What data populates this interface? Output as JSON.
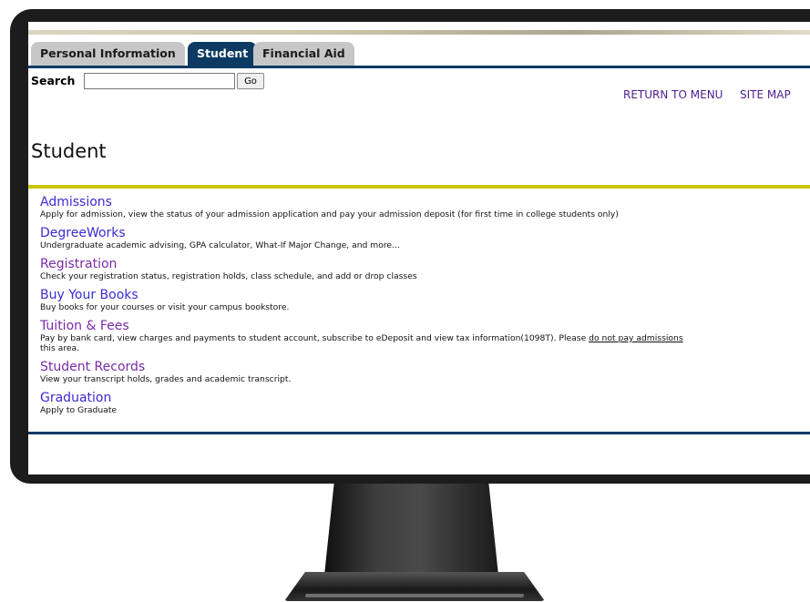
{
  "tabs": [
    {
      "label": "Personal Information",
      "active": false
    },
    {
      "label": "Student",
      "active": true
    },
    {
      "label": "Financial Aid",
      "active": false
    }
  ],
  "search": {
    "label": "Search",
    "value": "",
    "placeholder": "",
    "button_label": "Go"
  },
  "top_links": {
    "return_to_menu": "RETURN TO MENU",
    "site_map": "SITE MAP"
  },
  "page_title": "Student",
  "menu": [
    {
      "title": "Admissions",
      "description": "Apply for admission, view the status of your admission application and pay your admission deposit (for first time in college students only)"
    },
    {
      "title": "DegreeWorks",
      "description": "Undergraduate academic advising, GPA calculator, What-If Major Change, and more..."
    },
    {
      "title": "Registration",
      "description": "Check your registration status, registration holds, class schedule, and add or drop classes"
    },
    {
      "title": "Buy Your Books",
      "description": "Buy books for your courses or visit your campus bookstore."
    },
    {
      "title": "Tuition & Fees",
      "description_pre": "Pay by bank card, view charges and payments to student account, subscribe to eDeposit and view tax information(1098T). Please ",
      "description_link": "do not pay admissions",
      "description_post": "this area."
    },
    {
      "title": "Student Records",
      "description": "View your transcript holds, grades and academic transcript."
    },
    {
      "title": "Graduation",
      "description": "Apply to Graduate"
    }
  ],
  "colors": {
    "tab_active": "#0c3a63",
    "rule_yellow": "#c6c700",
    "link": "#3a2bd1",
    "link_visited": "#7a2aa8"
  }
}
